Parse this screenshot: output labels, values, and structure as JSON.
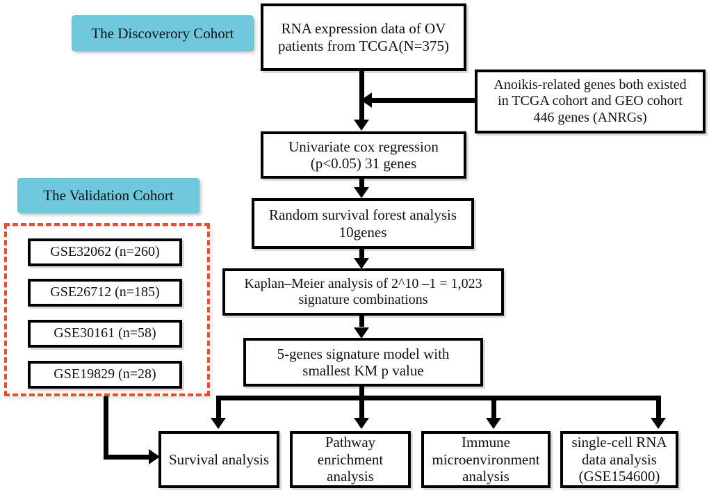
{
  "figure": {
    "type": "flowchart",
    "orientation": "top-down",
    "colors": {
      "cohort_label_fill": "#6FC8DC",
      "dashed_group_border": "#F04B2B",
      "node_border": "#000000",
      "node_fill": "#FFFFFF",
      "text": "#111111"
    }
  },
  "labels": {
    "discovery_cohort": "The Discoverory Cohort",
    "validation_cohort": "The Validation Cohort"
  },
  "nodes": {
    "tcga_data": "RNA expression data of OV\npatients from TCGA(N=375)",
    "anrgs": "Anoikis-related genes both existed\nin TCGA cohort and GEO cohort\n446 genes (ANRGs)",
    "univariate_cox": "Univariate cox regression\n(p<0.05)  31 genes",
    "random_forest": "Random survival forest analysis\n10genes",
    "kaplan_meier": "Kaplan–Meier analysis of 2^10 –1 = 1,023\nsignature combinations",
    "signature_model": "5-genes signature model with\nsmallest KM p value"
  },
  "validation_datasets": [
    {
      "label": "GSE32062 (n=260)"
    },
    {
      "label": "GSE26712 (n=185)"
    },
    {
      "label": "GSE30161 (n=58)"
    },
    {
      "label": "GSE19829 (n=28)"
    }
  ],
  "downstream_analyses": [
    {
      "label": "Survival analysis"
    },
    {
      "label": "Pathway\nenrichment\nanalysis"
    },
    {
      "label": "Immune\nmicroenvironment\nanalysis"
    },
    {
      "label": "single-cell RNA\ndata analysis\n(GSE154600)"
    }
  ]
}
